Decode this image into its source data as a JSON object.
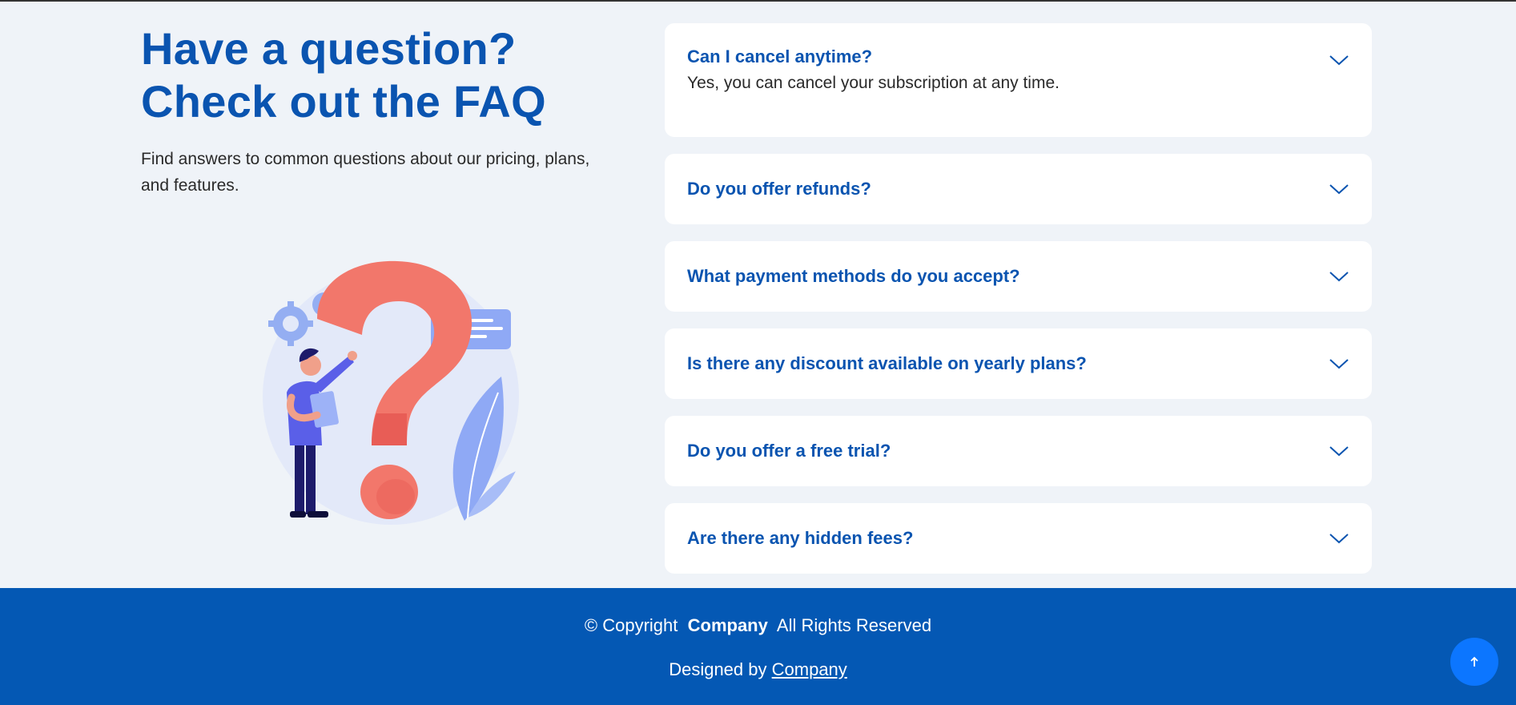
{
  "faq": {
    "heading_line1": "Have a question?",
    "heading_line2": "Check out the FAQ",
    "intro": "Find answers to common questions about our pricing, plans, and features.",
    "items": [
      {
        "question": "Can I cancel anytime?",
        "answer": "Yes, you can cancel your subscription at any time.",
        "expanded": true
      },
      {
        "question": "Do you offer refunds?",
        "expanded": false
      },
      {
        "question": "What payment methods do you accept?",
        "expanded": false
      },
      {
        "question": "Is there any discount available on yearly plans?",
        "expanded": false
      },
      {
        "question": "Do you offer a free trial?",
        "expanded": false
      },
      {
        "question": "Are there any hidden fees?",
        "expanded": false
      }
    ],
    "chevron_icon": "chevron-down-icon",
    "illustration": "question-mark-person-illustration"
  },
  "footer": {
    "copyright_prefix": "© Copyright",
    "company_name": "Company",
    "rights": "All Rights Reserved",
    "designed_by": "Designed by",
    "designer_link": "Company"
  },
  "scroll_top": {
    "icon": "arrow-up-icon"
  },
  "colors": {
    "brand_blue": "#0a54b0",
    "footer_bg": "#0458b4",
    "page_bg": "#eff3f8",
    "scroll_button": "#0c76ff",
    "illustration_red": "#f2776b",
    "illustration_periwinkle": "#8fa9f5"
  }
}
